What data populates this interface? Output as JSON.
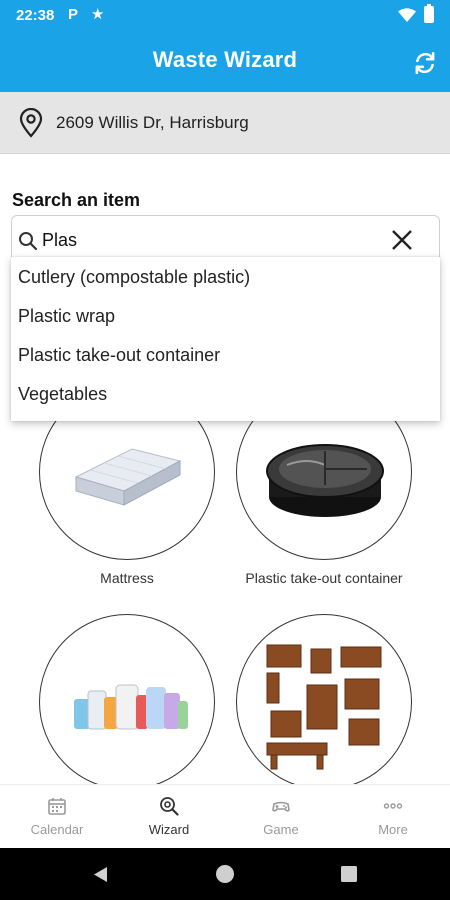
{
  "status_bar": {
    "time": "22:38",
    "p_glyph": "P",
    "star_glyph": "★"
  },
  "app_bar": {
    "title": "Waste Wizard",
    "background_color": "#1aa3e6",
    "refresh_icon": "refresh-icon"
  },
  "address_bar": {
    "icon": "map-pin-icon",
    "address": "2609 Willis Dr, Harrisburg"
  },
  "search": {
    "label": "Search an item",
    "value": "Plas",
    "search_icon": "search-icon",
    "clear_icon": "close-icon",
    "suggestions": [
      "Cutlery (compostable plastic)",
      "Plastic wrap",
      "Plastic take-out container",
      "Vegetables"
    ]
  },
  "items": [
    {
      "label": "Mattress",
      "image": "mattress-image"
    },
    {
      "label": "Plastic take-out container",
      "image": "take-out-container-image"
    },
    {
      "label": "",
      "image": "plastic-bottles-image"
    },
    {
      "label": "",
      "image": "furniture-image"
    }
  ],
  "bottom_nav": {
    "items": [
      {
        "label": "Calendar",
        "icon": "calendar-icon",
        "active": false
      },
      {
        "label": "Wizard",
        "icon": "wizard-icon",
        "active": true
      },
      {
        "label": "Game",
        "icon": "game-icon",
        "active": false
      },
      {
        "label": "More",
        "icon": "more-icon",
        "active": false
      }
    ]
  },
  "system_nav": {
    "icons": [
      "back-icon",
      "home-icon",
      "recents-icon"
    ]
  }
}
